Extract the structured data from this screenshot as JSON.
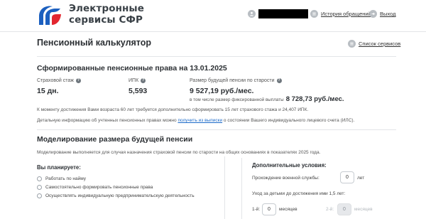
{
  "header": {
    "brand_line1": "Электронные",
    "brand_line2": "сервисы СФР",
    "history_link": "История обращений",
    "logout_link": "Выход",
    "icons": [
      "sfr-logo",
      "user-icon",
      "history-icon",
      "logout-icon"
    ]
  },
  "page": {
    "title": "Пенсионный калькулятор",
    "services_link": "Список сервисов"
  },
  "rights": {
    "title": "Сформированные пенсионные права на 13.01.2025",
    "experience_label": "Страховой стаж",
    "experience_value": "15 дн.",
    "ipk_label": "ИПК",
    "ipk_value": "5,593",
    "pension_label": "Размер будущей пенсии по старости",
    "pension_value": "9 527,19 руб./мес.",
    "fixed_label": "в том числе размер фиксированной выплаты",
    "fixed_value": "8 728,73 руб./мес.",
    "note1": "К моменту достижения Вами возраста 60 лет требуется дополнительно сформировать 15 лет страхового стажа и 24,407 ИПК.",
    "note2_before": "Детальную информацию об учтенных пенсионных правах можно ",
    "note2_link": "получить из выписки",
    "note2_after": " о состоянии Вашего индивидуального лицевого счета (ИЛС)."
  },
  "modeling": {
    "title": "Моделирование размера будущей пенсии",
    "note": "Моделирование выполняется для случая назначения страховой пенсии по старости на общих основаниях в показателях 2025 года.",
    "plan_title": "Вы планируете:",
    "options": [
      "Работать по найму",
      "Самостоятельно формировать пенсионные права",
      "Осуществлять индивидуальную предпринимательскую деятельность"
    ],
    "conditions_title": "Дополнительные условия:",
    "military_label": "Прохождение военной службы:",
    "military_value": "0",
    "military_unit": "лет",
    "care_label": "Уход за детьми до достижения ими 1,5 лет:",
    "child1_label": "1-й:",
    "child1_value": "0",
    "child1_unit": "месяцев",
    "child2_label": "2-й:",
    "child2_value": "0",
    "child2_unit": "месяцев"
  },
  "colors": {
    "logo_blue": "#1b5fbf",
    "logo_red": "#e3262f",
    "link_blue": "#1b6ac9",
    "text_dark": "#2b2f33"
  }
}
